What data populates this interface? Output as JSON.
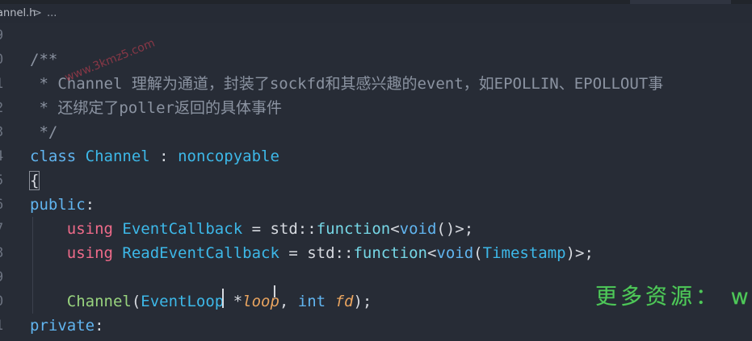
{
  "breadcrumb": {
    "file": "annel.h",
    "separator": ">",
    "more": "..."
  },
  "editor": {
    "lines": [
      {
        "number": "9",
        "tokens": []
      },
      {
        "number": "0",
        "tokens": [
          {
            "t": "/**",
            "c": "c-comment"
          }
        ]
      },
      {
        "number": "1",
        "tokens": [
          {
            "t": " * Channel 理解为通道，封装了sockfd和其感兴趣的event，如EPOLLIN、EPOLLOUT事",
            "c": "c-comment"
          }
        ]
      },
      {
        "number": "2",
        "tokens": [
          {
            "t": " * 还绑定了poller返回的具体事件",
            "c": "c-comment"
          }
        ]
      },
      {
        "number": "3",
        "tokens": [
          {
            "t": " */",
            "c": "c-comment"
          }
        ]
      },
      {
        "number": "4",
        "tokens": [
          {
            "t": "class",
            "c": "c-kw"
          },
          {
            "t": " ",
            "c": "c-plain"
          },
          {
            "t": "Channel",
            "c": "c-type"
          },
          {
            "t": " : ",
            "c": "c-op"
          },
          {
            "t": "noncopyable",
            "c": "c-type"
          }
        ]
      },
      {
        "number": "5",
        "tokens": [
          {
            "t": "{",
            "c": "c-plain brace-box"
          }
        ]
      },
      {
        "number": "6",
        "tokens": [
          {
            "t": "public",
            "c": "c-kw"
          },
          {
            "t": ":",
            "c": "c-plain"
          }
        ]
      },
      {
        "number": "7",
        "tokens": [
          {
            "t": "    ",
            "c": "c-plain"
          },
          {
            "t": "using",
            "c": "c-kw2"
          },
          {
            "t": " ",
            "c": "c-plain"
          },
          {
            "t": "EventCallback",
            "c": "c-type"
          },
          {
            "t": " = ",
            "c": "c-op"
          },
          {
            "t": "std",
            "c": "c-plain"
          },
          {
            "t": "::",
            "c": "c-op"
          },
          {
            "t": "function",
            "c": "c-fn"
          },
          {
            "t": "<",
            "c": "c-op"
          },
          {
            "t": "void",
            "c": "c-kw"
          },
          {
            "t": "()>;",
            "c": "c-plain"
          }
        ]
      },
      {
        "number": "8",
        "tokens": [
          {
            "t": "    ",
            "c": "c-plain"
          },
          {
            "t": "using",
            "c": "c-kw2"
          },
          {
            "t": " ",
            "c": "c-plain"
          },
          {
            "t": "ReadEventCallback",
            "c": "c-type"
          },
          {
            "t": " = ",
            "c": "c-op"
          },
          {
            "t": "std",
            "c": "c-plain"
          },
          {
            "t": "::",
            "c": "c-op"
          },
          {
            "t": "function",
            "c": "c-fn"
          },
          {
            "t": "<",
            "c": "c-op"
          },
          {
            "t": "void",
            "c": "c-kw"
          },
          {
            "t": "(",
            "c": "c-plain"
          },
          {
            "t": "Timestamp",
            "c": "c-type"
          },
          {
            "t": ")>;",
            "c": "c-plain"
          }
        ]
      },
      {
        "number": "9",
        "tokens": []
      },
      {
        "number": "0",
        "tokens": [
          {
            "t": "    ",
            "c": "c-plain"
          },
          {
            "t": "Channel",
            "c": "c-ctor"
          },
          {
            "t": "(",
            "c": "c-plain"
          },
          {
            "t": "EventLoop",
            "c": "c-type"
          },
          {
            "t": " *",
            "c": "c-op"
          },
          {
            "t": "loop",
            "c": "c-param"
          },
          {
            "t": ", ",
            "c": "c-plain"
          },
          {
            "t": "int",
            "c": "c-kw"
          },
          {
            "t": " ",
            "c": "c-plain"
          },
          {
            "t": "fd",
            "c": "c-param"
          },
          {
            "t": ");",
            "c": "c-plain"
          }
        ]
      },
      {
        "number": "1",
        "tokens": [
          {
            "t": "private",
            "c": "c-kw"
          },
          {
            "t": ":",
            "c": "c-plain"
          }
        ]
      }
    ]
  },
  "watermarks": {
    "diagonal": "www.3kmz5.com",
    "resource": "更多资源： ww"
  }
}
